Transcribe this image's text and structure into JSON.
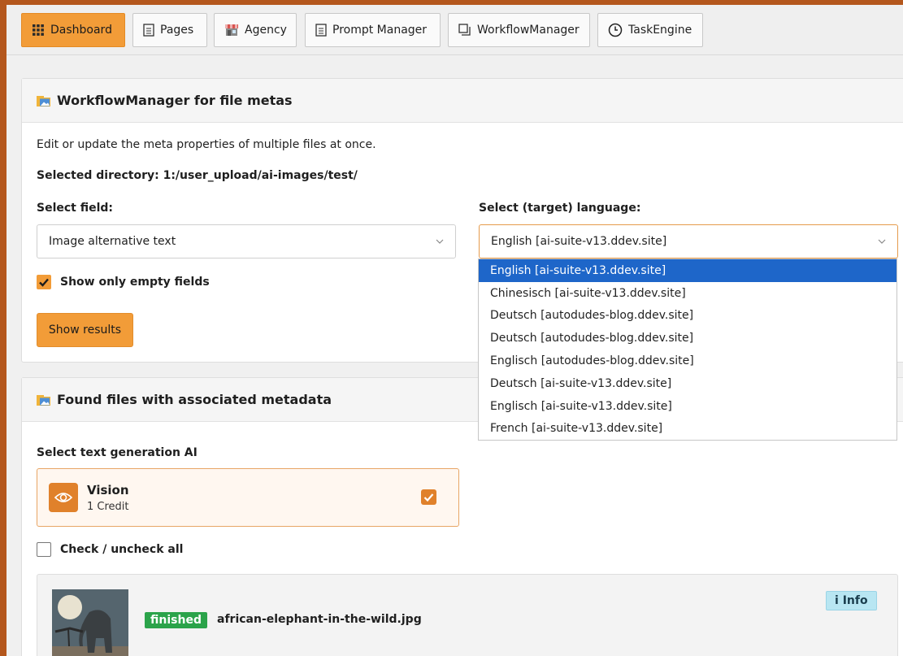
{
  "tabs": [
    {
      "label": "Dashboard",
      "icon": "grid-icon",
      "active": true
    },
    {
      "label": "Pages",
      "icon": "page-icon",
      "active": false
    },
    {
      "label": "Agency",
      "icon": "shop-icon",
      "active": false
    },
    {
      "label": "Prompt Manager",
      "icon": "document-icon",
      "active": false
    },
    {
      "label": "WorkflowManager",
      "icon": "copy-icon",
      "active": false
    },
    {
      "label": "TaskEngine",
      "icon": "clock-icon",
      "active": false
    }
  ],
  "meta_panel": {
    "title": "WorkflowManager for file metas",
    "description": "Edit or update the meta properties of multiple files at once.",
    "selected_directory": "Selected directory: 1:/user_upload/ai-images/test/",
    "field_label": "Select field:",
    "field_value": "Image alternative text",
    "language_label": "Select (target) language:",
    "language_value": "English [ai-suite-v13.ddev.site]",
    "show_empty_label": "Show only empty fields",
    "show_results_label": "Show results"
  },
  "language_options": [
    "English [ai-suite-v13.ddev.site]",
    "Chinesisch [ai-suite-v13.ddev.site]",
    "Deutsch [autodudes-blog.ddev.site]",
    "Deutsch [autodudes-blog.ddev.site]",
    "Englisch [autodudes-blog.ddev.site]",
    "Deutsch [ai-suite-v13.ddev.site]",
    "Englisch [ai-suite-v13.ddev.site]",
    "French [ai-suite-v13.ddev.site]"
  ],
  "files_panel": {
    "title": "Found files with associated metadata",
    "ai_label": "Select text generation AI",
    "ai_name": "Vision",
    "ai_credit": "1 Credit",
    "check_all_label": "Check / uncheck all",
    "file_status": "finished",
    "file_name": "african-elephant-in-the-wild.jpg",
    "info_label": "Info",
    "info_icon_glyph": "i"
  },
  "colors": {
    "accent": "#f29c38",
    "selected_option": "#1e66c9",
    "finished_badge": "#2ba34a",
    "info_button": "#b8e6f2",
    "background": "#b4571d"
  }
}
